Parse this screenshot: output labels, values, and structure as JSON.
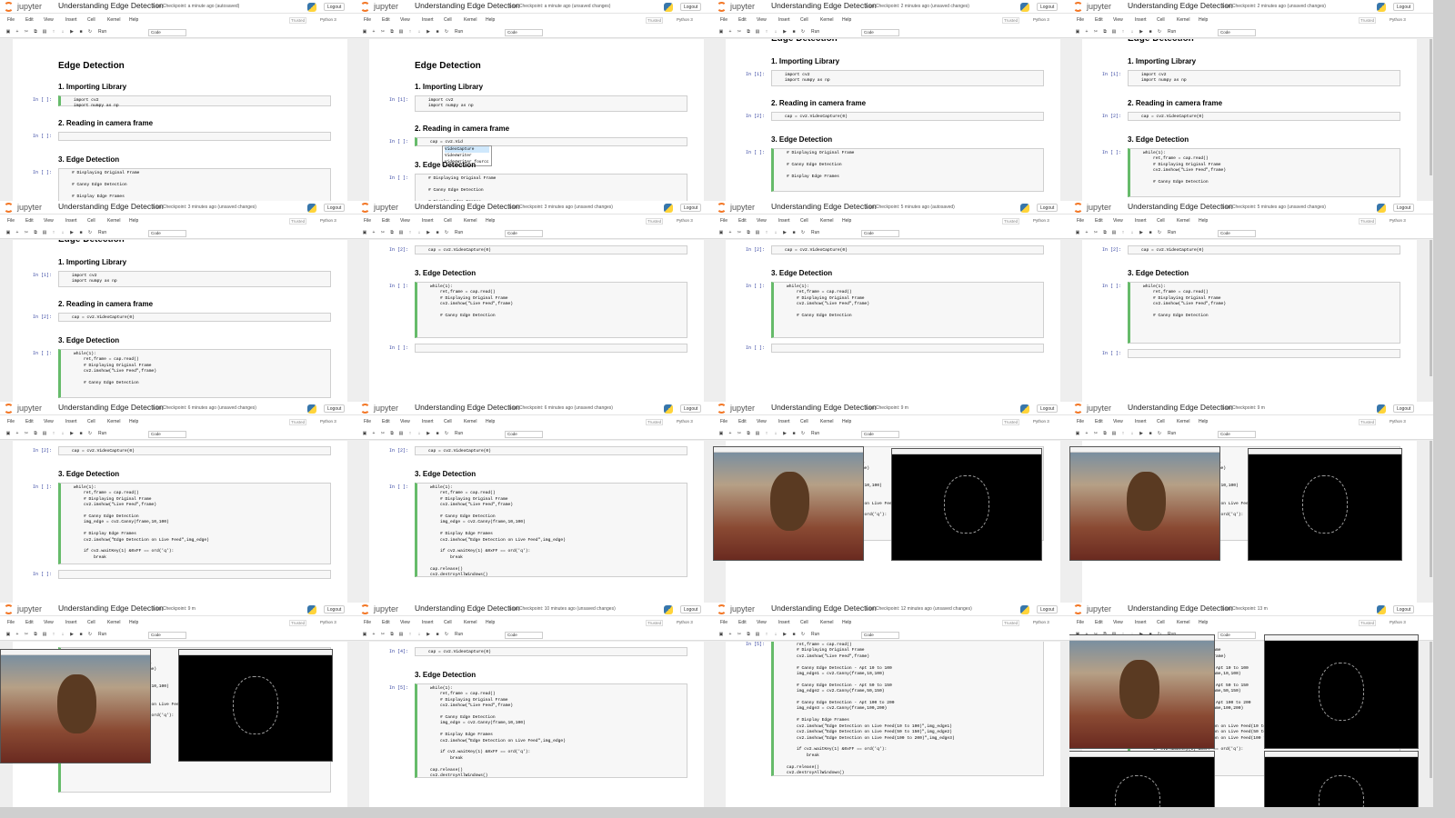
{
  "app": {
    "brand": "jupyter",
    "notebook_title": "Understanding Edge Detection",
    "logout": "Logout",
    "trusted": "Trusted",
    "kernel": "Python 3",
    "run": "Run",
    "cell_type": "Code",
    "menu": [
      "File",
      "Edit",
      "View",
      "Insert",
      "Cell",
      "Kernel",
      "Help"
    ]
  },
  "headings": {
    "h1": "Edge Detection",
    "s1": "1. Importing Library",
    "s2": "2. Reading in camera frame",
    "s3": "3. Edge Detection"
  },
  "prompts": {
    "empty": "In [ ]:",
    "one": "In [1]:",
    "two": "In [2]:",
    "four": "In [4]:",
    "five": "In [5]:"
  },
  "code": {
    "imports": "import cv2\nimport numpy as np",
    "capture": "cap = cv2.VideoCapture(0)",
    "capture_typing": "cap = cv2.Vid",
    "comments_only": "# Displaying Original Frame\n\n# Canny Edge Detection\n\n# Display Edge Frames",
    "loop_start": "while(1):\n    ret,frame = cap.read()\n    # Displaying Original Frame\n    cv2.imshow(\"Live Feed\",frame)\n\n    # Canny Edge Detection",
    "loop_canny": "while(1):\n    ret,frame = cap.read()\n    # Displaying Original Frame\n    cv2.imshow(\"Live Feed\",frame)\n\n    # Canny Edge Detection\n    img_edge = cv2.Canny(frame,10,100)\n\n    # Display Edge Frames\n    cv2.imshow(\"Edge Detection on Live Feed\",img_edge)\n\n    if cv2.waitKey(1) &0xFF == ord('q'):\n        break",
    "loop_full": "while(1):\n    ret,frame = cap.read()\n    # Displaying Original Frame\n    cv2.imshow(\"Live Feed\",frame)\n\n    # Canny Edge Detection\n    img_edge = cv2.Canny(frame,10,100)\n\n    # Display Edge Frames\n    cv2.imshow(\"Edge Detection on Live Feed\",img_edge)\n\n    if cv2.waitKey(1) &0xFF == ord('q'):\n        break\n\ncap.release()\ncv2.destroyAllWindows()",
    "loop_triple": "    ret,frame = cap.read()\n    # Displaying Original Frame\n    cv2.imshow(\"Live Feed\",frame)\n\n    # Canny Edge Detection - Apt 10 to 100\n    img_edge1 = cv2.Canny(frame,10,100)\n\n    # Canny Edge Detection - Apt 50 to 150\n    img_edge2 = cv2.Canny(frame,50,150)\n\n    # Canny Edge Detection - Apt 100 to 200\n    img_edge3 = cv2.Canny(frame,100,200)\n\n    # Display Edge Frames\n    cv2.imshow(\"Edge Detection on Live Feed(10 to 100)\",img_edge1)\n    cv2.imshow(\"Edge Detection on Live Feed(50 to 150)\",img_edge2)\n    cv2.imshow(\"Edge Detection on Live Feed(100 to 200)\",img_edge3)\n\n    if cv2.waitKey(1) &0xFF == ord('q'):\n        break\n\ncap.release()\ncv2.destroyAllWindows()"
  },
  "autocomplete": [
    "VideoCapture",
    "VideoWriter",
    "VideoWriter_fourcc"
  ],
  "frames": [
    {
      "ckpt": "Last Checkpoint: a minute ago  (autosaved)"
    },
    {
      "ckpt": "Last Checkpoint: a minute ago  (unsaved changes)"
    },
    {
      "ckpt": "Last Checkpoint: 2 minutes ago  (unsaved changes)"
    },
    {
      "ckpt": "Last Checkpoint: 2 minutes ago  (unsaved changes)"
    },
    {
      "ckpt": "Last Checkpoint: 3 minutes ago  (unsaved changes)"
    },
    {
      "ckpt": "Last Checkpoint: 3 minutes ago  (unsaved changes)"
    },
    {
      "ckpt": "Last Checkpoint: 5 minutes ago  (autosaved)"
    },
    {
      "ckpt": "Last Checkpoint: 5 minutes ago  (unsaved changes)"
    },
    {
      "ckpt": "Last Checkpoint: 6 minutes ago  (unsaved changes)"
    },
    {
      "ckpt": "Last Checkpoint: 6 minutes ago  (unsaved changes)"
    },
    {
      "ckpt": "Last Checkpoint: 9 m"
    },
    {
      "ckpt": "Last Checkpoint: 9 m"
    },
    {
      "ckpt": "Last Checkpoint: 9 m"
    },
    {
      "ckpt": "Last Checkpoint: 10 minutes ago  (unsaved changes)"
    },
    {
      "ckpt": "Last Checkpoint: 12 minutes ago  (unsaved changes)"
    },
    {
      "ckpt": "Last Checkpoint: 13 m"
    }
  ]
}
